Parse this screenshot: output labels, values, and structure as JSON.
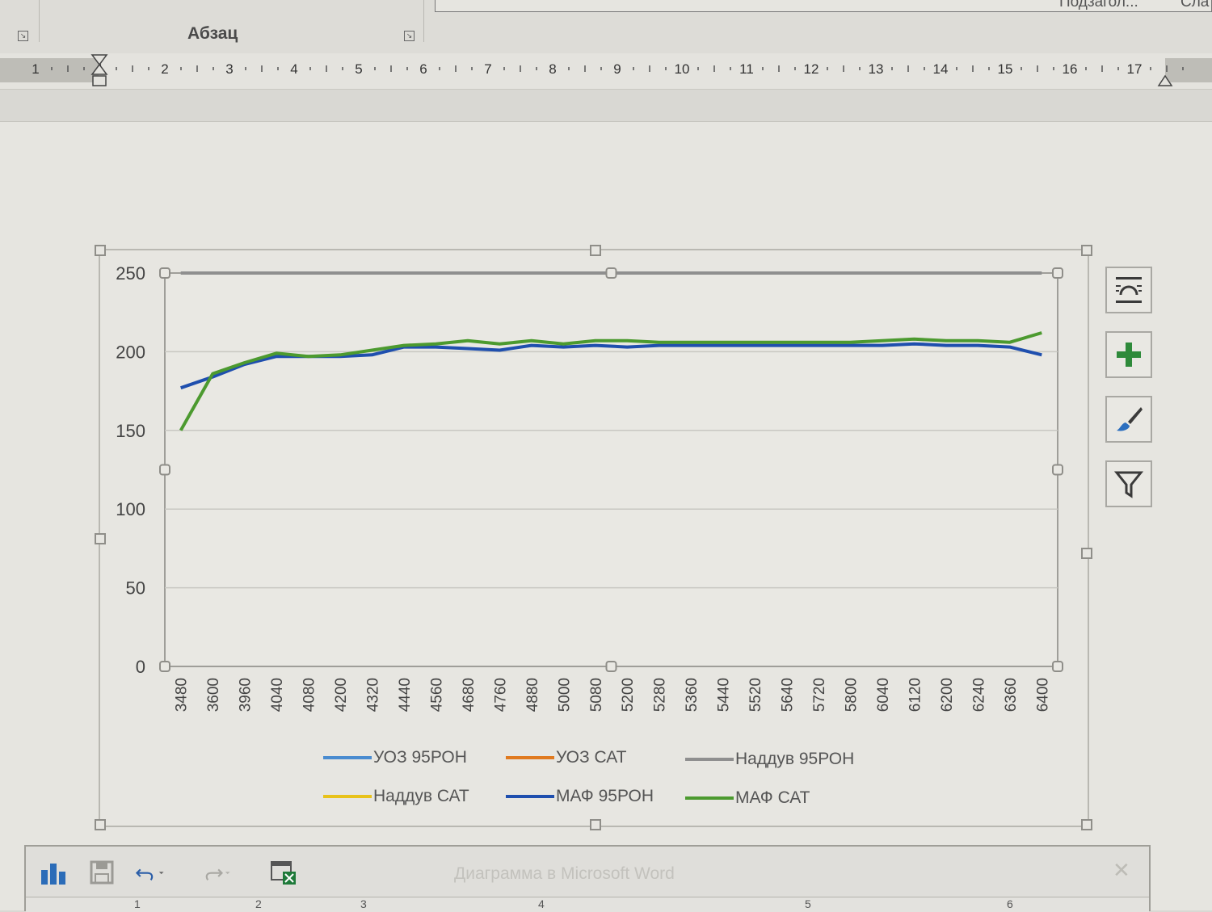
{
  "ribbon": {
    "group_label": "Абзац",
    "style_gallery_labels": [
      "",
      "Подзагол...",
      "Сла"
    ]
  },
  "ruler": {
    "labels": [
      "1",
      "1",
      "2",
      "3",
      "4",
      "5",
      "6",
      "7",
      "8",
      "9",
      "10",
      "11",
      "12",
      "13",
      "14",
      "15",
      "16",
      "17"
    ]
  },
  "chart_data": {
    "type": "line",
    "categories": [
      "3480",
      "3600",
      "3960",
      "4040",
      "4080",
      "4200",
      "4320",
      "4440",
      "4560",
      "4680",
      "4760",
      "4880",
      "5000",
      "5080",
      "5200",
      "5280",
      "5360",
      "5440",
      "5520",
      "5640",
      "5720",
      "5800",
      "6040",
      "6120",
      "6200",
      "6240",
      "6360",
      "6400"
    ],
    "ylim": [
      0,
      250
    ],
    "yticks": [
      0,
      50,
      100,
      150,
      200,
      250
    ],
    "grid": true,
    "legend_position": "bottom",
    "series": [
      {
        "name": "УОЗ 95РОН",
        "color": "#4a8cd0",
        "values": []
      },
      {
        "name": "УОЗ САТ",
        "color": "#e07a1f",
        "values": []
      },
      {
        "name": "Наддув 95РОН",
        "color": "#8f8f8f",
        "values": [
          250,
          250,
          250,
          250,
          250,
          250,
          250,
          250,
          250,
          250,
          250,
          250,
          250,
          250,
          250,
          250,
          250,
          250,
          250,
          250,
          250,
          250,
          250,
          250,
          250,
          250,
          250,
          250
        ]
      },
      {
        "name": "Наддув САТ",
        "color": "#e8c21a",
        "values": []
      },
      {
        "name": "МАФ 95РОН",
        "color": "#1f4fae",
        "values": [
          177,
          184,
          192,
          197,
          197,
          197,
          198,
          203,
          203,
          202,
          201,
          204,
          203,
          204,
          203,
          204,
          204,
          204,
          204,
          204,
          204,
          204,
          204,
          205,
          204,
          204,
          203,
          198
        ]
      },
      {
        "name": "МАФ САТ",
        "color": "#4c9a2f",
        "values": [
          150,
          186,
          193,
          199,
          197,
          198,
          201,
          204,
          205,
          207,
          205,
          207,
          205,
          207,
          207,
          206,
          206,
          206,
          206,
          206,
          206,
          206,
          207,
          208,
          207,
          207,
          206,
          212
        ]
      }
    ]
  },
  "side_buttons": [
    {
      "name": "layout-options",
      "icon": "layout-options-icon"
    },
    {
      "name": "chart-elements",
      "icon": "plus-icon"
    },
    {
      "name": "chart-styles",
      "icon": "paintbrush-icon"
    },
    {
      "name": "chart-filters",
      "icon": "filter-icon"
    }
  ],
  "data_window": {
    "title": "Диаграмма в Microsoft Word",
    "column_labels": [
      "1",
      "2",
      "3",
      "4",
      "5",
      "6"
    ]
  }
}
